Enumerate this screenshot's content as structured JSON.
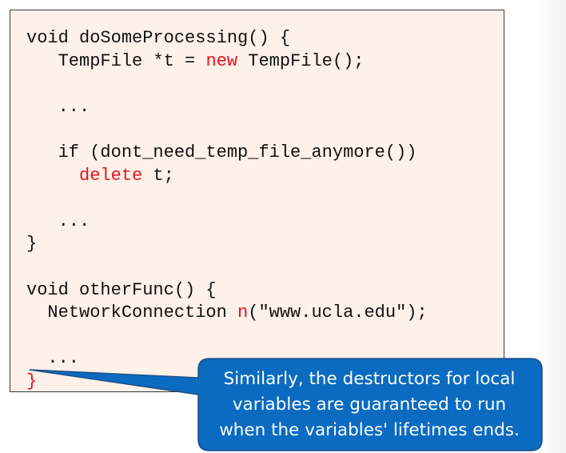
{
  "code_lines": [
    {
      "segments": [
        "void doSomeProcessing() {"
      ]
    },
    {
      "segments": [
        "   TempFile *t = ",
        "new",
        " TempFile();"
      ],
      "keyword_index": 1
    },
    {
      "segments": [
        ""
      ]
    },
    {
      "segments": [
        "   ..."
      ]
    },
    {
      "segments": [
        ""
      ]
    },
    {
      "segments": [
        "   if (dont_need_temp_file_anymore())"
      ]
    },
    {
      "segments": [
        "     ",
        "delete",
        " t;"
      ],
      "keyword_index": 1
    },
    {
      "segments": [
        ""
      ]
    },
    {
      "segments": [
        "   ..."
      ]
    },
    {
      "segments": [
        "}"
      ]
    },
    {
      "segments": [
        ""
      ]
    },
    {
      "segments": [
        "void otherFunc() {"
      ]
    },
    {
      "segments": [
        "  NetworkConnection ",
        "n",
        "(\"www.ucla.edu\");"
      ],
      "keyword_index": 1
    },
    {
      "segments": [
        ""
      ]
    },
    {
      "segments": [
        "  ..."
      ]
    },
    {
      "segments": [
        "",
        "}"
      ],
      "keyword_index": 1
    }
  ],
  "callout": {
    "lines": [
      "Similarly, the destructors for local",
      "variables are guaranteed to run",
      "when the variables' lifetimes ends."
    ],
    "fill_color": "#0a6bc0",
    "border_color": "#1f4f86"
  },
  "colors": {
    "code_background": "#fdf1ea",
    "keyword": "#e8141c",
    "text": "#111111"
  }
}
